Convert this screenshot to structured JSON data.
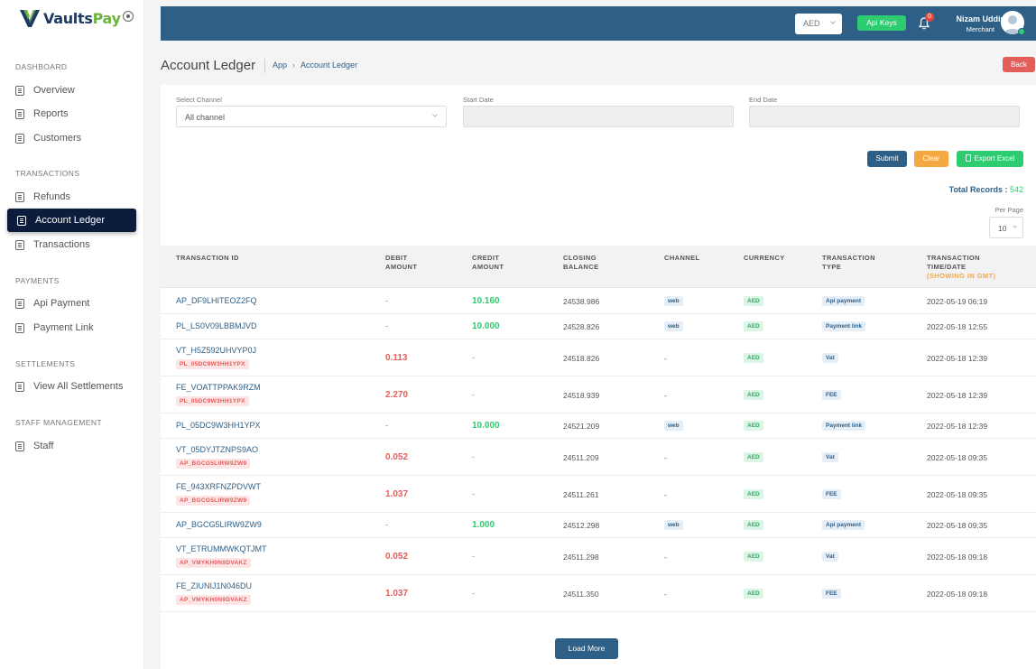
{
  "brand": {
    "part1": "Vaults",
    "part2": "Pay",
    "icon": "vaultspay-logo"
  },
  "sidebar": {
    "sections": [
      {
        "title": "DASHBOARD",
        "items": [
          {
            "label": "Overview"
          },
          {
            "label": "Reports"
          },
          {
            "label": "Customers"
          }
        ]
      },
      {
        "title": "TRANSACTIONS",
        "items": [
          {
            "label": "Refunds"
          },
          {
            "label": "Account Ledger",
            "active": true
          },
          {
            "label": "Transactions"
          }
        ]
      },
      {
        "title": "PAYMENTS",
        "items": [
          {
            "label": "Api Payment"
          },
          {
            "label": "Payment Link"
          }
        ]
      },
      {
        "title": "SETTLEMENTS",
        "items": [
          {
            "label": "View All Settlements"
          }
        ]
      },
      {
        "title": "STAFF MANAGEMENT",
        "items": [
          {
            "label": "Staff"
          }
        ]
      }
    ]
  },
  "topbar": {
    "currency": "AED",
    "api_keys_label": "Api Keys",
    "notification_count": "0",
    "user_name": "Nizam Uddin",
    "user_role": "Merchant"
  },
  "page": {
    "title": "Account Ledger",
    "breadcrumb": [
      "App",
      "Account Ledger"
    ],
    "back_label": "Back"
  },
  "filters": {
    "channel_label": "Select Channel",
    "channel_value": "All channel",
    "start_label": "Start Date",
    "start_value": "",
    "end_label": "End Date",
    "end_value": "",
    "submit_label": "Submit",
    "clear_label": "Clear",
    "export_label": "Export Excel",
    "total_label": "Total Records :",
    "total_value": "542",
    "per_page_label": "Per Page",
    "per_page_value": "10"
  },
  "table": {
    "headers": {
      "txid": "TRANSACTION ID",
      "debit1": "DEBIT",
      "debit2": "AMOUNT",
      "credit1": "CREDIT",
      "credit2": "AMOUNT",
      "closing1": "CLOSING",
      "closing2": "BALANCE",
      "channel": "CHANNEL",
      "currency": "CURRENCY",
      "type1": "TRANSACTION",
      "type2": "TYPE",
      "time1": "TRANSACTION",
      "time2": "TIME/DATE",
      "time3": "(SHOWING IN GMT)"
    },
    "rows": [
      {
        "txid": "AP_DF9LHITEOZ2FQ",
        "ref": "",
        "debit": "-",
        "credit": "10.160",
        "closing": "24538.986",
        "channel": "web",
        "currency": "AED",
        "type": "Api payment",
        "time": "2022-05-19 06:19"
      },
      {
        "txid": "PL_LS0V09LBBMJVD",
        "ref": "",
        "debit": "-",
        "credit": "10.000",
        "closing": "24528.826",
        "channel": "web",
        "currency": "AED",
        "type": "Payment link",
        "time": "2022-05-18 12:55"
      },
      {
        "txid": "VT_H5Z592UHVYP0J",
        "ref": "PL_05DC9W3HH1YPX",
        "debit": "0.113",
        "credit": "-",
        "closing": "24518.826",
        "channel": "-",
        "currency": "AED",
        "type": "Vat",
        "time": "2022-05-18 12:39"
      },
      {
        "txid": "FE_VOATTPPAK9RZM",
        "ref": "PL_05DC9W3HH1YPX",
        "debit": "2.270",
        "credit": "-",
        "closing": "24518.939",
        "channel": "-",
        "currency": "AED",
        "type": "FEE",
        "time": "2022-05-18 12:39"
      },
      {
        "txid": "PL_05DC9W3HH1YPX",
        "ref": "",
        "debit": "-",
        "credit": "10.000",
        "closing": "24521.209",
        "channel": "web",
        "currency": "AED",
        "type": "Payment link",
        "time": "2022-05-18 12:39"
      },
      {
        "txid": "VT_05DYJTZNPS9AO",
        "ref": "AP_BGCG5LIRW9ZW9",
        "debit": "0.052",
        "credit": "-",
        "closing": "24511.209",
        "channel": "-",
        "currency": "AED",
        "type": "Vat",
        "time": "2022-05-18 09:35"
      },
      {
        "txid": "FE_943XRFNZPDVWT",
        "ref": "AP_BGCG5LIRW9ZW9",
        "debit": "1.037",
        "credit": "-",
        "closing": "24511.261",
        "channel": "-",
        "currency": "AED",
        "type": "FEE",
        "time": "2022-05-18 09:35"
      },
      {
        "txid": "AP_BGCG5LIRW9ZW9",
        "ref": "",
        "debit": "-",
        "credit": "1.000",
        "closing": "24512.298",
        "channel": "web",
        "currency": "AED",
        "type": "Api payment",
        "time": "2022-05-18 09:35"
      },
      {
        "txid": "VT_ETRUMMWKQTJMT",
        "ref": "AP_VMYKH0N9DVAKZ",
        "debit": "0.052",
        "credit": "-",
        "closing": "24511.298",
        "channel": "-",
        "currency": "AED",
        "type": "Vat",
        "time": "2022-05-18 09:18"
      },
      {
        "txid": "FE_ZIUNIJ1N046DU",
        "ref": "AP_VMYKH0N9DVAKZ",
        "debit": "1.037",
        "credit": "-",
        "closing": "24511.350",
        "channel": "-",
        "currency": "AED",
        "type": "FEE",
        "time": "2022-05-18 09:18"
      }
    ],
    "load_more_label": "Load More"
  }
}
